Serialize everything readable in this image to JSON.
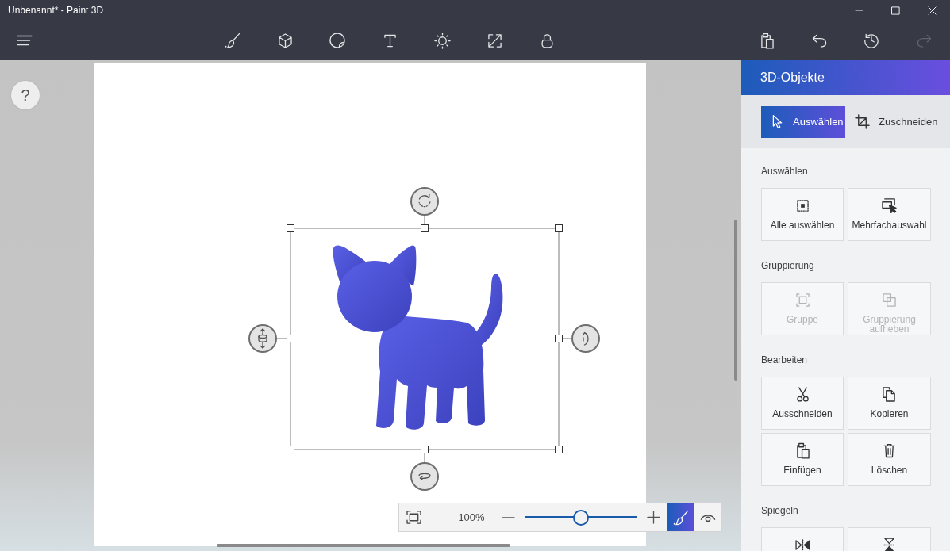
{
  "window": {
    "title": "Unbenannt* - Paint 3D"
  },
  "toolbar": {
    "actions": [
      {
        "disabled": false
      },
      {
        "disabled": false
      },
      {
        "disabled": false
      },
      {
        "disabled": true
      }
    ]
  },
  "canvas": {
    "help_button": {
      "label": "?"
    }
  },
  "zoom_bar": {
    "zoom": "100%",
    "level": 0.5,
    "view_modes": [
      {
        "selected": true
      },
      {
        "selected": false
      }
    ]
  },
  "panel": {
    "title": "3D-Objekte",
    "modes": [
      {
        "label": "Auswählen",
        "selected": true
      },
      {
        "label": "Zuschneiden",
        "selected": false
      }
    ],
    "sections": [
      {
        "title": "Auswählen",
        "buttons": [
          {
            "label": "Alle auswählen",
            "disabled": false
          },
          {
            "label": "Mehrfachauswahl",
            "disabled": false
          }
        ]
      },
      {
        "title": "Gruppierung",
        "buttons": [
          {
            "label": "Gruppe",
            "disabled": true
          },
          {
            "label": "Gruppierung aufheben",
            "disabled": true
          }
        ]
      },
      {
        "title": "Bearbeiten",
        "buttons": [
          {
            "label": "Ausschneiden",
            "disabled": false
          },
          {
            "label": "Kopieren",
            "disabled": false
          },
          {
            "label": "Einfügen",
            "disabled": false
          },
          {
            "label": "Löschen",
            "disabled": false
          }
        ]
      },
      {
        "title": "Spiegeln",
        "buttons": [
          {
            "disabled": false
          },
          {
            "disabled": false
          }
        ]
      }
    ]
  }
}
